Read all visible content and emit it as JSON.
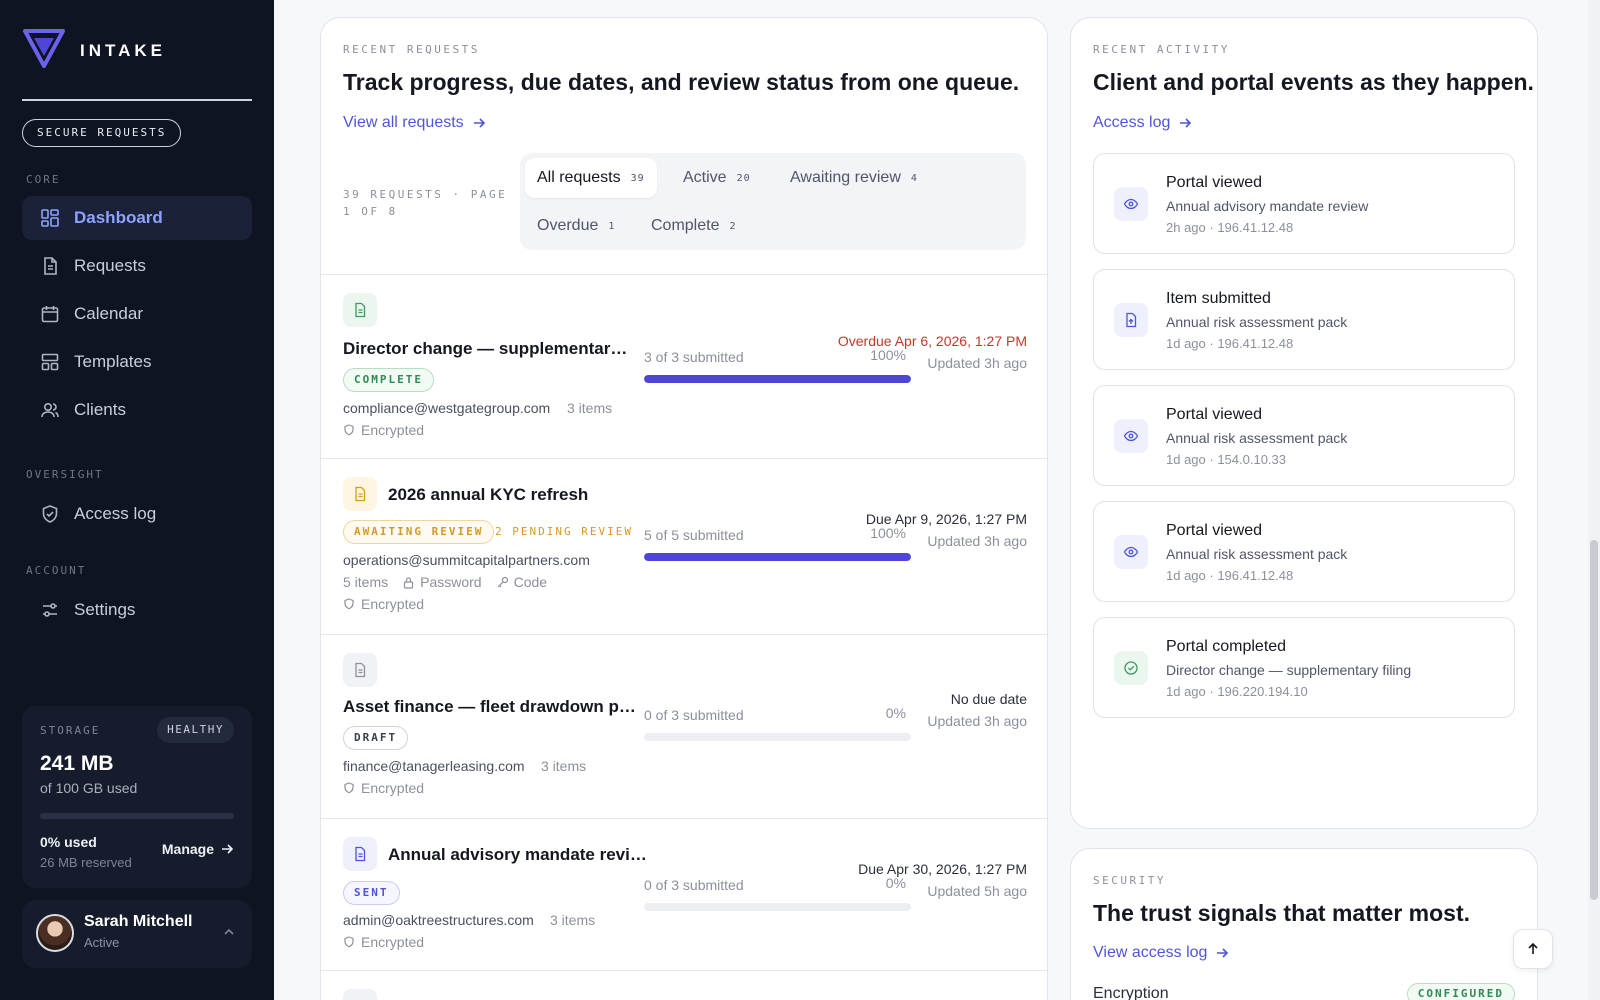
{
  "brand": {
    "name": "INTAKE",
    "badge": "SECURE REQUESTS"
  },
  "sidebar": {
    "sections": {
      "core": "CORE",
      "oversight": "OVERSIGHT",
      "account": "ACCOUNT"
    },
    "items": [
      {
        "label": "Dashboard",
        "icon": "dashboard-icon",
        "active": true
      },
      {
        "label": "Requests",
        "icon": "document-icon"
      },
      {
        "label": "Calendar",
        "icon": "calendar-icon"
      },
      {
        "label": "Templates",
        "icon": "templates-icon"
      },
      {
        "label": "Clients",
        "icon": "users-icon"
      },
      {
        "label": "Access log",
        "icon": "shield-icon"
      },
      {
        "label": "Settings",
        "icon": "sliders-icon"
      }
    ],
    "storage": {
      "label": "STORAGE",
      "status": "HEALTHY",
      "amount": "241 MB",
      "sub": "of 100 GB used",
      "used": "0% used",
      "used_fraction": 0.0,
      "reserved": "26 MB reserved",
      "manage": "Manage"
    },
    "user": {
      "name": "Sarah Mitchell",
      "status": "Active"
    }
  },
  "requests": {
    "eyebrow": "RECENT REQUESTS",
    "title": "Track progress, due dates, and review status from one queue.",
    "link": "View all requests",
    "count_text": "39 REQUESTS · PAGE 1 OF 8",
    "tabs": [
      {
        "label": "All requests",
        "count": "39",
        "active": true
      },
      {
        "label": "Active",
        "count": "20"
      },
      {
        "label": "Awaiting review",
        "count": "4"
      },
      {
        "label": "Overdue",
        "count": "1"
      },
      {
        "label": "Complete",
        "count": "2"
      }
    ],
    "rows": [
      {
        "title": "Director change — supplementary fil...",
        "status": "COMPLETE",
        "email": "compliance@westgategroup.com",
        "items": "3 items",
        "encrypted": "Encrypted",
        "submitted": "3 of 3 submitted",
        "percent": "100%",
        "progress": 1.0,
        "due": "Overdue Apr 6, 2026, 1:27 PM",
        "updated": "Updated 3h ago"
      },
      {
        "title": "2026 annual KYC refresh",
        "status": "AWAITING REVIEW",
        "pending": "2 PENDING REVIEW",
        "email": "operations@summitcapitalpartners.com",
        "items": "5 items",
        "password": "Password",
        "code": "Code",
        "encrypted": "Encrypted",
        "submitted": "5 of 5 submitted",
        "percent": "100%",
        "progress": 1.0,
        "due": "Due Apr 9, 2026, 1:27 PM",
        "updated": "Updated 3h ago"
      },
      {
        "title": "Asset finance — fleet drawdown pack",
        "status": "DRAFT",
        "email": "finance@tanagerleasing.com",
        "items": "3 items",
        "encrypted": "Encrypted",
        "submitted": "0 of 3 submitted",
        "percent": "0%",
        "progress": 0.0,
        "due": "No due date",
        "updated": "Updated 3h ago"
      },
      {
        "title": "Annual advisory mandate review",
        "status": "SENT",
        "email": "admin@oaktreestructures.com",
        "items": "3 items",
        "encrypted": "Encrypted",
        "submitted": "0 of 3 submitted",
        "percent": "0%",
        "progress": 0.0,
        "due": "Due Apr 30, 2026, 1:27 PM",
        "updated": "Updated 5h ago"
      }
    ]
  },
  "activity": {
    "eyebrow": "RECENT ACTIVITY",
    "title": "Client and portal events as they happen.",
    "link": "Access log",
    "events": [
      {
        "title": "Portal viewed",
        "sub": "Annual advisory mandate review",
        "meta": "2h ago · 196.41.12.48",
        "icon": "eye-icon"
      },
      {
        "title": "Item submitted",
        "sub": "Annual risk assessment pack",
        "meta": "1d ago · 196.41.12.48",
        "icon": "file-upload-icon"
      },
      {
        "title": "Portal viewed",
        "sub": "Annual risk assessment pack",
        "meta": "1d ago · 154.0.10.33",
        "icon": "eye-icon"
      },
      {
        "title": "Portal viewed",
        "sub": "Annual risk assessment pack",
        "meta": "1d ago · 196.41.12.48",
        "icon": "eye-icon"
      },
      {
        "title": "Portal completed",
        "sub": "Director change — supplementary filing",
        "meta": "1d ago · 196.220.194.10",
        "icon": "check-circle-icon"
      }
    ]
  },
  "security": {
    "eyebrow": "SECURITY",
    "title": "The trust signals that matter most.",
    "link": "View access log",
    "encryption_label": "Encryption",
    "encryption_status": "CONFIGURED"
  },
  "colors": {
    "accent": "#4f46d8",
    "sidebar_bg": "#0f1422",
    "overdue": "#c0392b",
    "complete": "#2f8a55",
    "awaiting": "#d59a2a"
  }
}
